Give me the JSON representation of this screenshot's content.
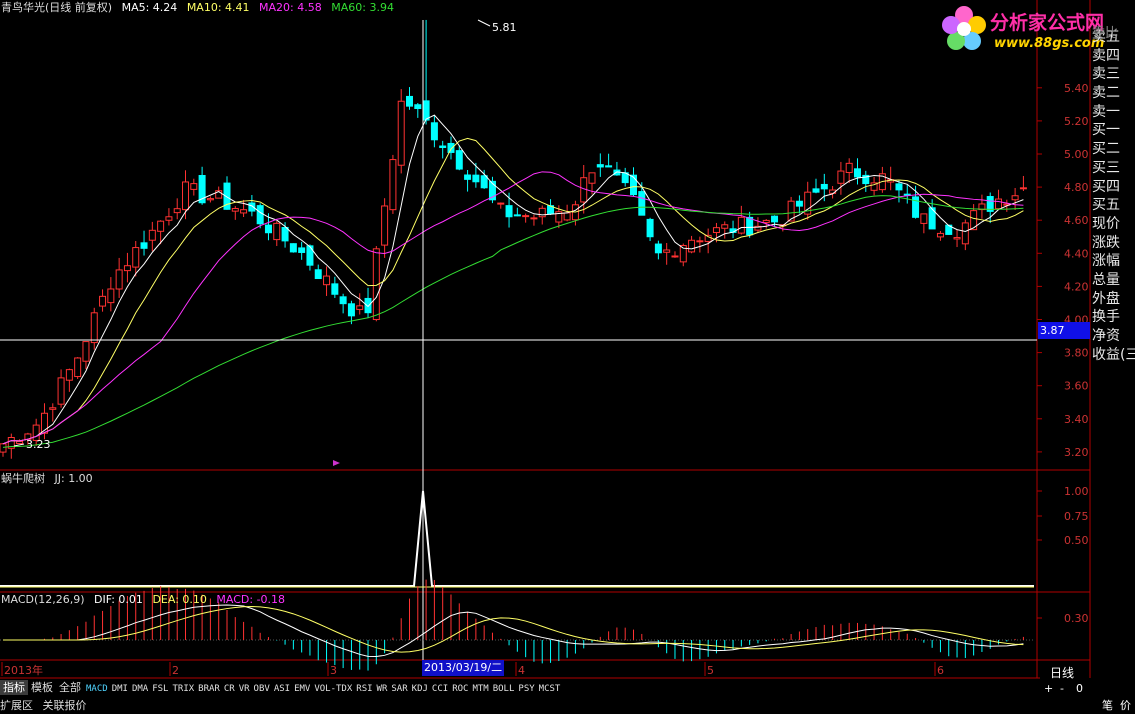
{
  "header": {
    "title": "青鸟华光(日线 前复权)",
    "ma5": "MA5: 4.24",
    "ma10": "MA10: 4.41",
    "ma20": "MA20: 4.58",
    "ma60": "MA60: 3.94"
  },
  "indicator1": {
    "title": "蜗牛爬树",
    "jj": "JJ: 1.00"
  },
  "macd": {
    "title": "MACD(12,26,9)",
    "dif": "DIF: 0.01",
    "dea": "DEA: 0.10",
    "macd": "MACD: -0.18"
  },
  "price_axis": [
    "5.40",
    "5.20",
    "5.00",
    "4.80",
    "4.60",
    "4.40",
    "4.20",
    "4.00",
    "3.80",
    "3.60",
    "3.40",
    "3.20"
  ],
  "ind_axis": [
    "1.00",
    "0.75",
    "0.50"
  ],
  "macd_axis": [
    "0.30"
  ],
  "annotations": {
    "high": "5.81",
    "low": "3.23",
    "crosshair_price": "3.87",
    "crosshair_date": "2013/03/19/二"
  },
  "time_axis": [
    "2013年",
    "2",
    "3",
    "4",
    "5",
    "6"
  ],
  "side_panel": [
    "卖五",
    "卖四",
    "卖三",
    "卖二",
    "卖一",
    "买一",
    "买二",
    "买三",
    "买四",
    "买五",
    "现价",
    "涨跌",
    "涨幅",
    "总量",
    "外盘",
    "换手",
    "净资",
    "收益(三"
  ],
  "side_top": "委比",
  "logo": {
    "name": "分析家公式网",
    "url": "www.88gs.com"
  },
  "tabs": [
    "指标",
    "模板",
    "全部",
    "MACD",
    "DMI",
    "DMA",
    "FSL",
    "TRIX",
    "BRAR",
    "CR",
    "VR",
    "OBV",
    "ASI",
    "EMV",
    "VOL-TDX",
    "RSI",
    "WR",
    "SAR",
    "KDJ",
    "CCI",
    "ROC",
    "MTM",
    "BOLL",
    "PSY",
    "MCST"
  ],
  "bottom_tabs": [
    "扩展区",
    "关联报价"
  ],
  "right_bottom": {
    "period": "日线",
    "plus": "+",
    "minus": "-",
    "zero": "0",
    "a": "笔",
    "b": "价"
  },
  "colors": {
    "up": "#ff3232",
    "down": "#00ffff",
    "ma5": "#ffffff",
    "ma10": "#ffff66",
    "ma20": "#ff33ff",
    "ma60": "#33dd33",
    "axis": "#b00000",
    "macd": "#ff33ff"
  }
}
